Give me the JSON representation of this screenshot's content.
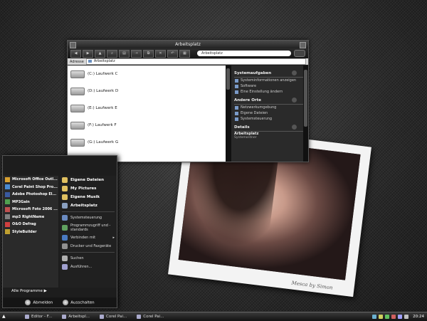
{
  "explorer": {
    "title": "Arbeitsplatz",
    "search_placeholder": "Arbeitsplatz",
    "address_label": "Adresse",
    "address_value": "Arbeitsplatz",
    "drives": [
      {
        "label": "(C:) Laufwerk C"
      },
      {
        "label": "(D:) Laufwerk D"
      },
      {
        "label": "(E:) Laufwerk E"
      },
      {
        "label": "(F:) Laufwerk F"
      },
      {
        "label": "(G:) Laufwerk G"
      }
    ],
    "panels": {
      "system_tasks": {
        "title": "Systemaufgaben",
        "links": [
          "Systeminformationen anzeigen",
          "Software",
          "Eine Einstellung ändern"
        ]
      },
      "other_places": {
        "title": "Andere Orte",
        "links": [
          "Netzwerkumgebung",
          "Eigene Dateien",
          "Systemsteuerung"
        ]
      },
      "details": {
        "title": "Details",
        "name": "Arbeitsplatz",
        "sub": "Systemordner"
      }
    }
  },
  "start_menu": {
    "pinned": [
      {
        "label": "Microsoft Office Outl...",
        "color": "#d8a030"
      },
      {
        "label": "Corel Paint Shop Pro...",
        "color": "#4a8ad0"
      },
      {
        "label": "Adobe Photoshop El...",
        "color": "#3a5aa0"
      },
      {
        "label": "MP3Gain",
        "color": "#50a050"
      },
      {
        "label": "Microsoft Foto 2006 ...",
        "color": "#c05050"
      },
      {
        "label": "mp3 RightName",
        "color": "#808080"
      },
      {
        "label": "O&O Defrag",
        "color": "#d04040"
      },
      {
        "label": "StyleBuilder",
        "color": "#c0a030"
      }
    ],
    "right_bold": [
      "Eigene Dateien",
      "My Pictures",
      "Eigene Musik",
      "Arbeitsplatz"
    ],
    "right_items": [
      "Systemsteuerung",
      "Programmzugriff und -standards",
      "Verbinden mit",
      "Drucker und Faxgeräte",
      "Suchen",
      "Ausführen..."
    ],
    "all_programs": "Alle Programme",
    "logoff": "Abmelden",
    "shutdown": "Ausschalten"
  },
  "taskbar": {
    "tasks": [
      "Editor - F...",
      "Arbeitspl...",
      "Corel Pai...",
      "Corel Pai..."
    ],
    "clock": "20:24"
  },
  "photo": {
    "signature": "Mesca by Simon"
  }
}
